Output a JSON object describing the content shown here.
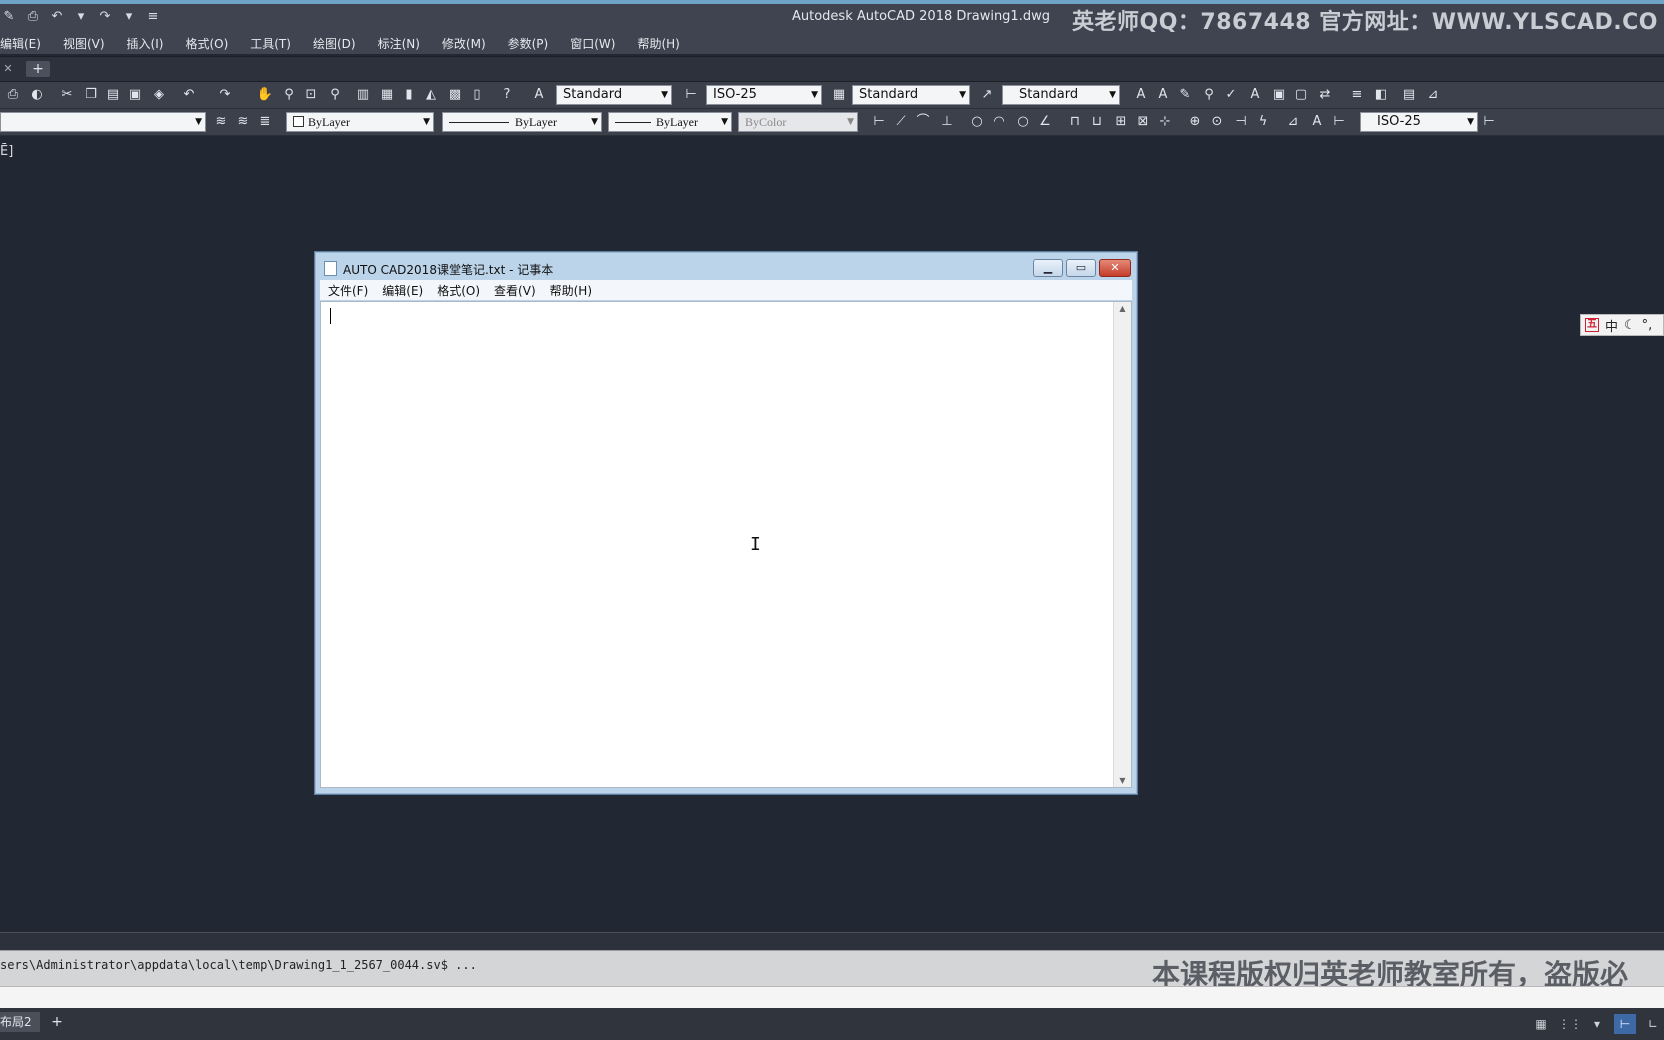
{
  "title_bar": {
    "app_title": "Autodesk AutoCAD 2018    Drawing1.dwg",
    "watermark": "英老师QQ：7867448  官方网址：WWW.YLSCAD.CO"
  },
  "menu_bar": {
    "items": [
      "编辑(E)",
      "视图(V)",
      "插入(I)",
      "格式(O)",
      "工具(T)",
      "绘图(D)",
      "标注(N)",
      "修改(M)",
      "参数(P)",
      "窗口(W)",
      "帮助(H)"
    ]
  },
  "toolbar_row1": {
    "text_style": "Standard",
    "dim_style": "ISO-25",
    "table_style": "Standard",
    "mleader_style": "Standard"
  },
  "toolbar_row2": {
    "color": "ByLayer",
    "linetype": "ByLayer",
    "lineweight": "ByLayer",
    "plot_style": "ByColor",
    "dim_style": "ISO-25"
  },
  "viewport": {
    "label": "Ē]"
  },
  "ime": {
    "mode": "中"
  },
  "notepad": {
    "title": "AUTO CAD2018课堂笔记.txt - 记事本",
    "menu": [
      "文件(F)",
      "编辑(E)",
      "格式(O)",
      "查看(V)",
      "帮助(H)"
    ],
    "content": ""
  },
  "command": {
    "history": "sers\\Administrator\\appdata\\local\\temp\\Drawing1_1_2567_0044.sv$ ...",
    "watermark": "本课程版权归英老师教室所有，盗版必"
  },
  "layout": {
    "tab": "布局2"
  }
}
